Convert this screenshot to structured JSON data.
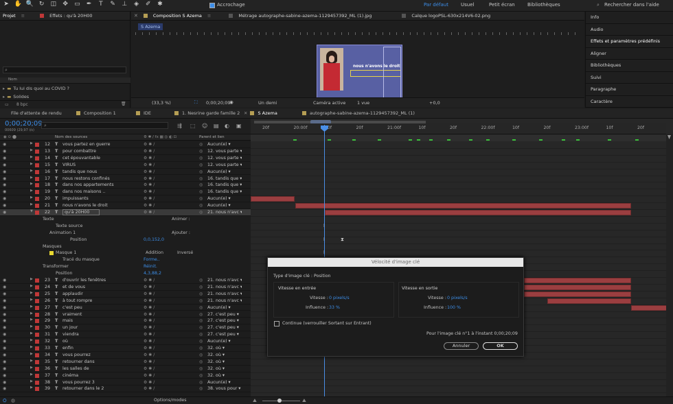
{
  "toolbar": {
    "snapping": "Accrochage",
    "workspace_active": "Par défaut",
    "workspaces": [
      "Usuel",
      "Petit écran",
      "Bibliothèques"
    ],
    "search": "Rechercher dans l'aide"
  },
  "project": {
    "tab": "Projet",
    "effects_tab": "Effets : qu'à 20H00",
    "col_name": "Nom",
    "items": [
      "Tu lui dis quoi au COVID ?",
      "Solides"
    ],
    "bpc": "8 bpc"
  },
  "viewer": {
    "tabs": [
      "Composition S Azema",
      "Métrage autographe-sabine-azema-1129457392_ML (1).jpg",
      "Calque logoPSL-630x214V6-02.png"
    ],
    "crumb": "S Azema",
    "zoom": "(33,3 %)",
    "timecode": "0;00;20;09",
    "resolution": "Un demi",
    "camera": "Caméra active",
    "views": "1 vue",
    "offset": "+0,0",
    "overlay_text": "nous n'avons le droit"
  },
  "right_panels": [
    "Info",
    "Audio",
    "Effets et paramètres prédéfinis",
    "Aligner",
    "Bibliothèques",
    "Suivi",
    "Paragraphe",
    "Caractère"
  ],
  "tl_tabs": [
    "File d'attente de rendu",
    "Composition 1",
    "IDE",
    "1. Nesrine garde famille 2",
    "S Azema",
    "autographe-sabine-azema-1129457392_ML (1)"
  ],
  "timeline": {
    "timecode": "0;00;20;09",
    "fps": "00609 (29,97 i/s)",
    "col_source": "Nom des sources",
    "col_parent": "Parent et lien",
    "ruler": [
      "20f",
      "20:00f",
      "10f",
      "20f",
      "21:00f",
      "10f",
      "20f",
      "22:00f",
      "10f",
      "20f",
      "23:00f",
      "10f",
      "20f"
    ]
  },
  "layers_top": [
    {
      "n": "12",
      "name": "vous partez en guerre",
      "parent": "Aucun(e)"
    },
    {
      "n": "13",
      "name": "pour combattre",
      "parent": "12. vous parte"
    },
    {
      "n": "14",
      "name": "cet épouvantable",
      "parent": "12. vous parte"
    },
    {
      "n": "15",
      "name": "VIRUS",
      "parent": "12. vous parte"
    },
    {
      "n": "16",
      "name": "tandis que nous",
      "parent": "Aucun(e)"
    },
    {
      "n": "17",
      "name": "nous restons confinés",
      "parent": "16. tandis que"
    },
    {
      "n": "18",
      "name": "dans nos appartements",
      "parent": "16. tandis que"
    },
    {
      "n": "19",
      "name": "dans nos maisons ..",
      "parent": "16. tandis que"
    },
    {
      "n": "20",
      "name": "impuissants",
      "parent": "Aucun(e)"
    },
    {
      "n": "21",
      "name": "nous n'avons le droit",
      "parent": "Aucun(e)"
    },
    {
      "n": "22",
      "name": "qu'à 20H00",
      "parent": "21. nous n'avc"
    }
  ],
  "props": {
    "texte": "Texte",
    "animer": "Animer :",
    "source": "Texte source",
    "anim": "Animation 1",
    "ajouter": "Ajouter :",
    "position": "Position",
    "pos_val": "0,0,152,0",
    "masques": "Masques",
    "masque1": "Masque 1",
    "addition": "Addition",
    "inverse": "Inversé",
    "trace": "Tracé du masque",
    "forme": "Forme..",
    "transformer": "Transformer",
    "reinit": "Réinit.",
    "pos2": "Position",
    "pos2_val": "4,3,88,2"
  },
  "layers_bottom": [
    {
      "n": "23",
      "name": "d'ouvrir les fenêtres",
      "parent": "21. nous n'avc"
    },
    {
      "n": "24",
      "name": "et de vous",
      "parent": "21. nous n'avc"
    },
    {
      "n": "25",
      "name": "applaudir",
      "parent": "21. nous n'avc"
    },
    {
      "n": "26",
      "name": "à tout rompre",
      "parent": "21. nous n'avc"
    },
    {
      "n": "27",
      "name": "c'est peu",
      "parent": "Aucun(e)"
    },
    {
      "n": "28",
      "name": "vraiment",
      "parent": "27. c'est peu"
    },
    {
      "n": "29",
      "name": "mais",
      "parent": "27. c'est peu"
    },
    {
      "n": "30",
      "name": "un jour",
      "parent": "27. c'est peu"
    },
    {
      "n": "31",
      "name": "viendra",
      "parent": "27. c'est peu"
    },
    {
      "n": "32",
      "name": "où",
      "parent": "Aucun(e)"
    },
    {
      "n": "33",
      "name": "enfin",
      "parent": "32. où"
    },
    {
      "n": "34",
      "name": "vous pourrez",
      "parent": "32. où"
    },
    {
      "n": "35",
      "name": "retourner dans",
      "parent": "32. où"
    },
    {
      "n": "36",
      "name": "les salles de",
      "parent": "32. où"
    },
    {
      "n": "37",
      "name": "cinéma",
      "parent": "32. où"
    },
    {
      "n": "38",
      "name": "vous pourrez 3",
      "parent": "Aucun(e)"
    },
    {
      "n": "39",
      "name": "retourner dans le 2",
      "parent": "38. vous pour"
    }
  ],
  "bottom": {
    "toggle": "Options/modes"
  },
  "dialog": {
    "title": "Vélocité d'image clé",
    "type": "Type d'image clé : Position",
    "in_title": "Vitesse en entrée",
    "out_title": "Vitesse en sortie",
    "speed_label": "Vitesse :",
    "speed_val": "0 pixels/s",
    "infl_label": "Influence :",
    "in_infl": "33 %",
    "out_infl": "100 %",
    "continuous": "Continue (verrouiller Sortant sur Entrant)",
    "for_frame": "Pour l'image clé n°1 à l'instant 0;00;20;09",
    "cancel": "Annuler",
    "ok": "OK"
  },
  "colors": {
    "accent": "#3d8ee8",
    "bar": "#9b3e40",
    "label_red": "#c03838"
  }
}
